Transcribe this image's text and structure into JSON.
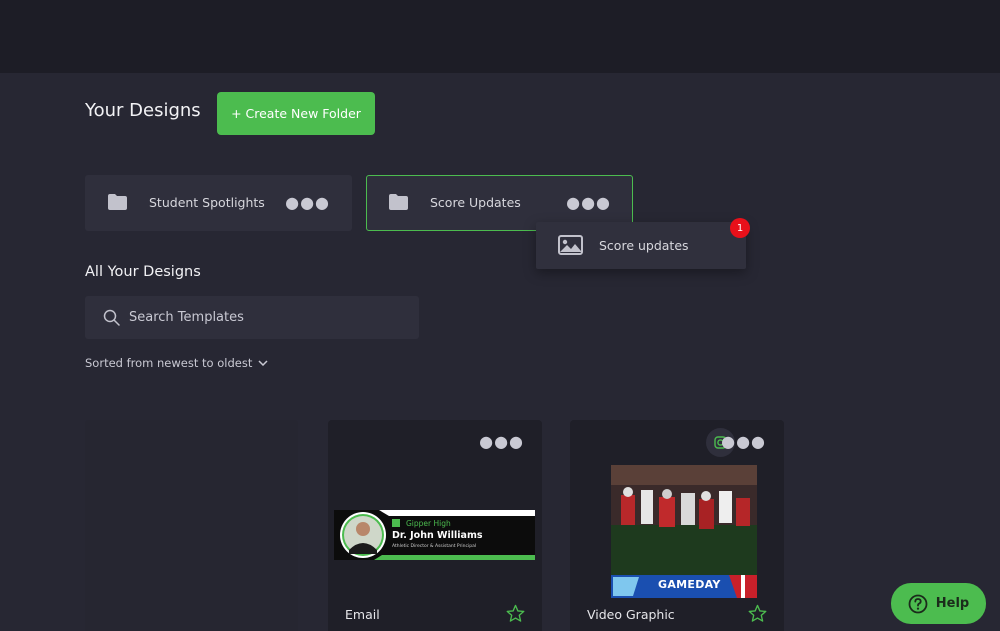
{
  "header": {
    "title": "Your Designs",
    "create_folder_label": "+ Create New Folder"
  },
  "folders": [
    {
      "name": "Student Spotlights",
      "selected": false
    },
    {
      "name": "Score Updates",
      "selected": true
    }
  ],
  "folder_dropdown": {
    "items": [
      {
        "label": "Score updates",
        "icon": "image-icon"
      }
    ],
    "badge_count": "1"
  },
  "designs": {
    "title": "All Your Designs",
    "search_placeholder": "Search Templates",
    "sort_label": "Sorted from newest to oldest"
  },
  "cards": [
    {
      "name": "Email",
      "thumb": {
        "school": "Gipper High",
        "person": "Dr. John Williams",
        "role": "Athletic Director & Assistant Principal"
      }
    },
    {
      "name": "Video Graphic",
      "thumb": {
        "banner": "GAMEDAY"
      }
    }
  ],
  "help": {
    "label": "Help"
  },
  "colors": {
    "accent": "#4cbc4f",
    "background": "#272733",
    "topbar": "#1d1d26",
    "panel": "#2f2f3c",
    "badge": "#e8101a"
  }
}
